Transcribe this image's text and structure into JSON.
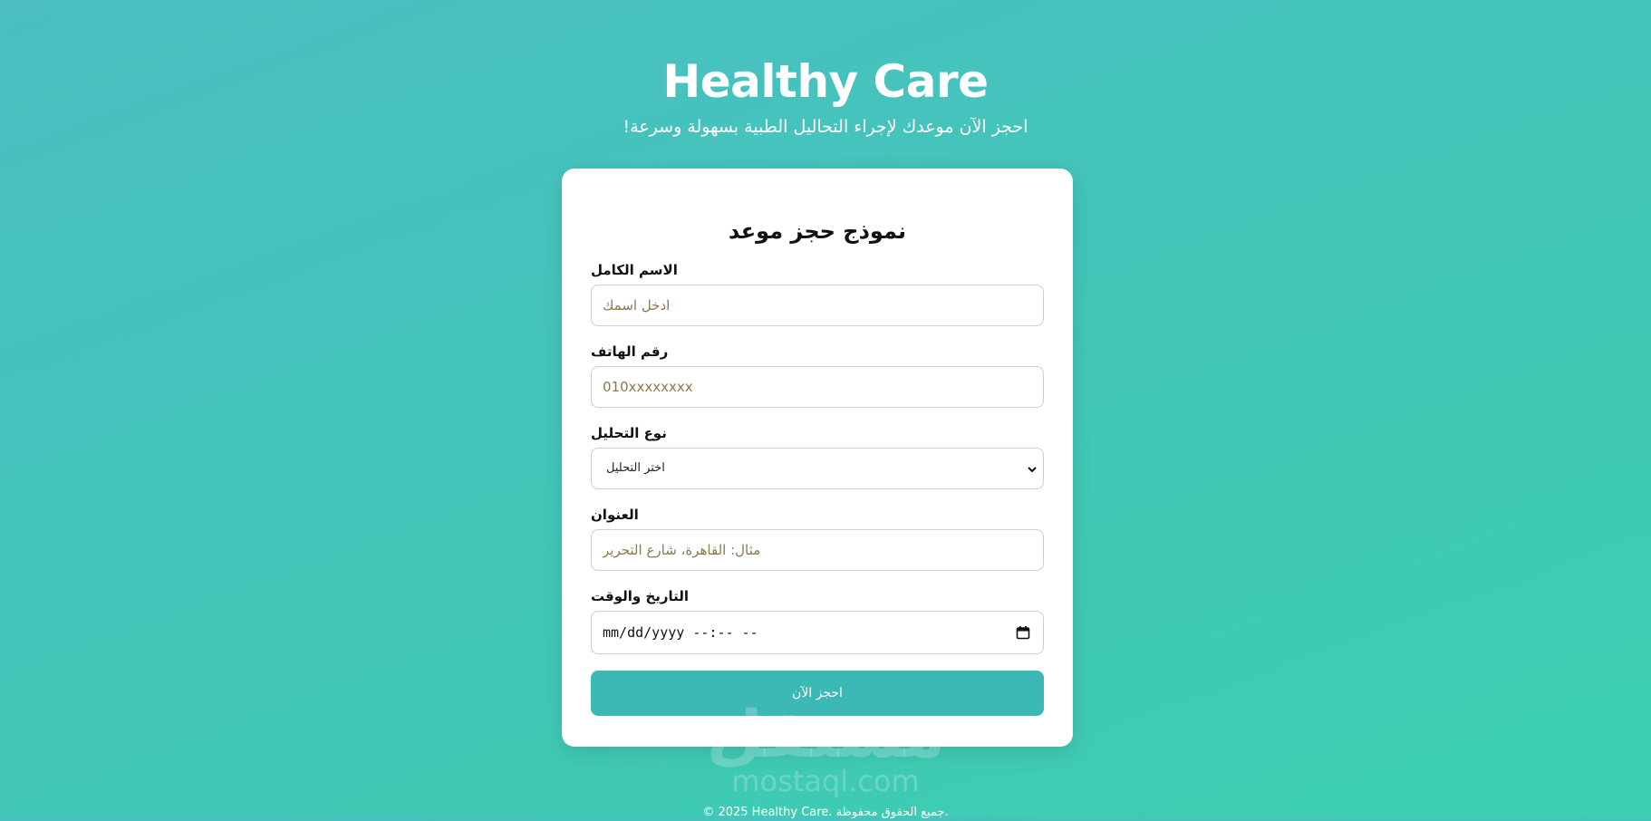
{
  "header": {
    "title": "Healthy Care",
    "tagline": "!احجز الآن موعدك لإجراء التحاليل الطبية بسهولة وسرعة"
  },
  "form": {
    "title": "نموذج حجز موعد",
    "fields": {
      "name": {
        "label": "الاسم الكامل",
        "placeholder": "ادخل اسمك",
        "value": ""
      },
      "phone": {
        "label": "رقم الهاتف",
        "placeholder": "010xxxxxxxx",
        "value": ""
      },
      "test_type": {
        "label": "نوع التحليل",
        "selected": "اختر التحليل"
      },
      "address": {
        "label": "العنوان",
        "placeholder": "مثال: القاهرة، شارع التحرير",
        "value": ""
      },
      "datetime": {
        "label": "التاريخ والوقت",
        "value": "mm/dd/yyyy --:-- --"
      }
    },
    "submit_label": "احجز الآن"
  },
  "watermark": {
    "logo_text": "مستقل",
    "url": "mostaql.com"
  },
  "footer": {
    "text": "© 2025 Healthy Care. جميع الحقوق محفوظة."
  },
  "icons": {
    "select_chevron": "chevron-down-icon",
    "date_picker": "calendar-icon"
  },
  "colors": {
    "background_start": "#4bbfc3",
    "background_end": "#3ccfaf",
    "button": "#3cb8b5",
    "card": "#ffffff",
    "placeholder": "#8a7a4e"
  }
}
